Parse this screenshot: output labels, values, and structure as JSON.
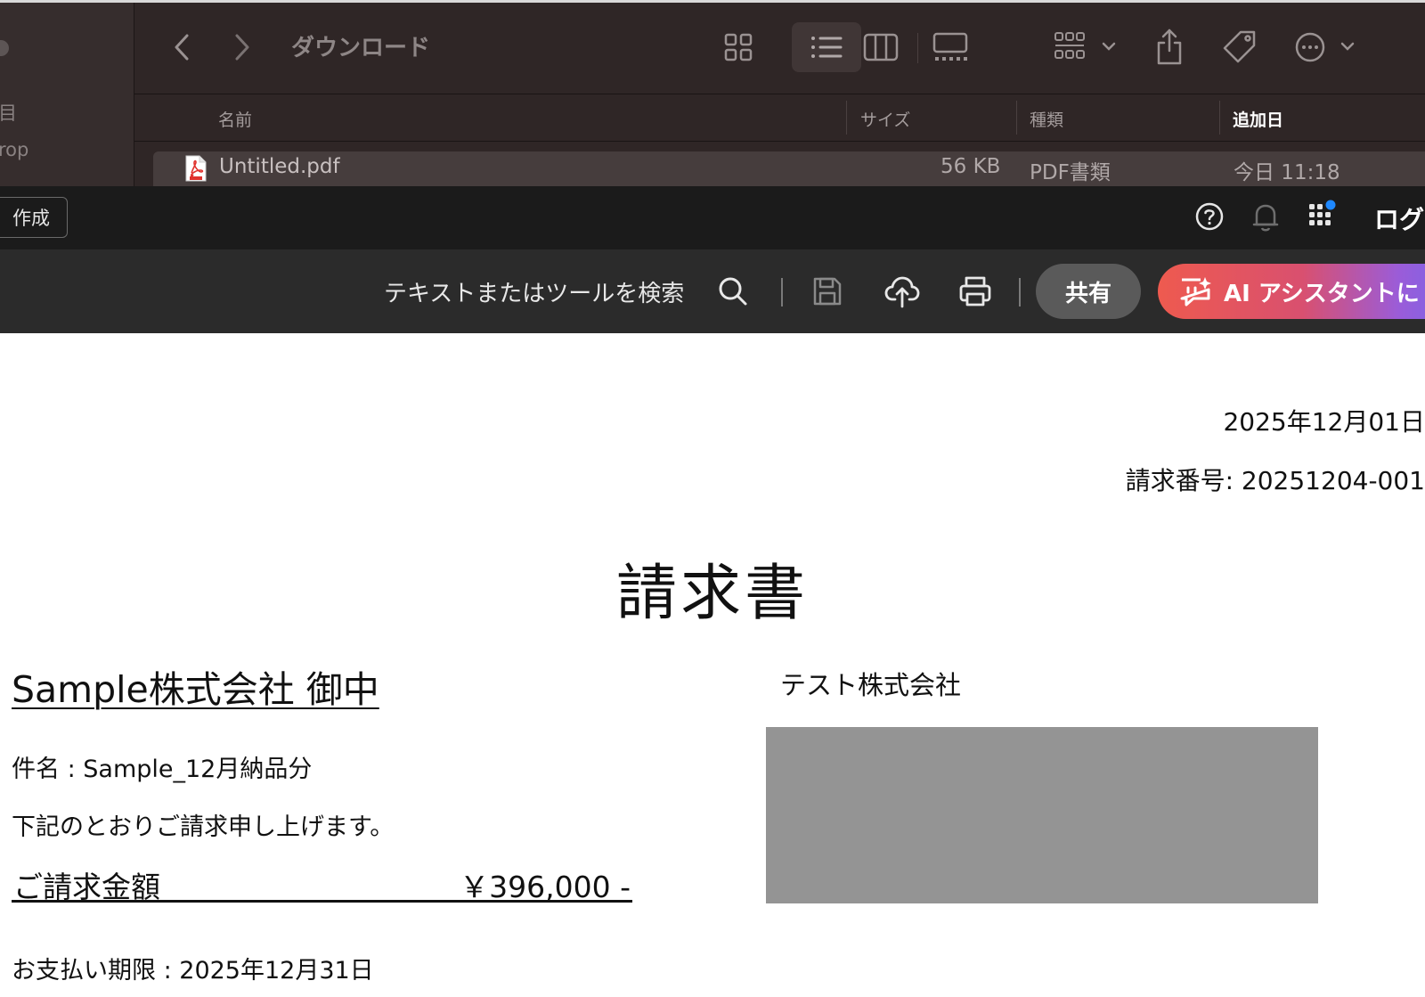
{
  "finder": {
    "sidebar": {
      "items": [
        "目",
        "rop"
      ]
    },
    "toolbar": {
      "title": "ダウンロード"
    },
    "columns": {
      "name": "名前",
      "size": "サイズ",
      "kind": "種類",
      "added": "追加日"
    },
    "row": {
      "name": "Untitled.pdf",
      "size": "56 KB",
      "kind": "PDF書類",
      "added": "今日 11:18"
    }
  },
  "acrobat": {
    "top": {
      "create_label": "作成",
      "login_label": "ログ"
    },
    "toolbar": {
      "search_text": "テキストまたはツールを検索",
      "share_label": "共有",
      "ai_label": "AI アシスタントに"
    }
  },
  "document": {
    "date": "2025年12月01日",
    "invoice_number": "請求番号: 20251204-001",
    "title": "請求書",
    "recipient": "Sample株式会社 御中",
    "issuer": "テスト株式会社",
    "subject": "件名 : Sample_12月納品分",
    "intro": "下記のとおりご請求申し上げます。",
    "amount_label": "ご請求金額",
    "amount_value": "￥396,000 -",
    "due_date": "お支払い期限 : 2025年12月31日"
  },
  "colors": {
    "finder_bg": "#2f2626",
    "acrobat_topbar": "#1b1b1b",
    "acrobat_toolbar": "#2b2b2b",
    "ai_gradient_start": "#ee5a4f",
    "ai_gradient_end": "#6d68f0",
    "notification_dot": "#1e88ff",
    "pdf_icon_red": "#e0322d"
  }
}
